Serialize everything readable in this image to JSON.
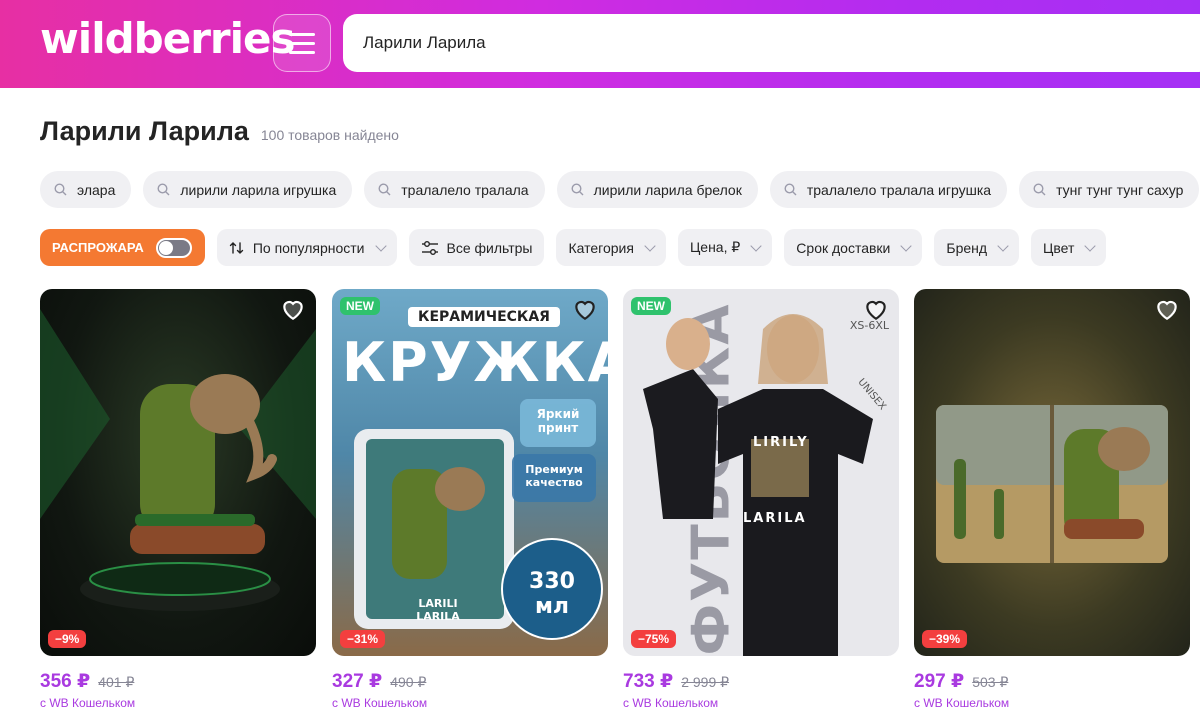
{
  "header": {
    "logo": "wildberries",
    "search_value": "Ларили Ларила"
  },
  "page": {
    "title": "Ларили Ларила",
    "count": "100 товаров найдено"
  },
  "suggestions": [
    "элара",
    "лирили ларила игрушка",
    "тралалело тралала",
    "лирили ларила брелок",
    "тралалело тралала игрушка",
    "тунг тунг тунг сахур"
  ],
  "filters": {
    "sale_label": "РАСПРОЖАРА",
    "sort_label": "По популярности",
    "all_filters": "Все фильтры",
    "category": "Категория",
    "price": "Цена, ₽",
    "delivery": "Срок доставки",
    "brand": "Бренд",
    "color": "Цвет"
  },
  "products": [
    {
      "price": "356 ₽",
      "old_price": "401 ₽",
      "discount": "−9%",
      "wallet": "с WB Кошельком",
      "new": false
    },
    {
      "price": "327 ₽",
      "old_price": "490 ₽",
      "discount": "−31%",
      "wallet": "с WB Кошельком",
      "new": true,
      "img_texts": {
        "t1": "КЕРАМИЧЕСКАЯ",
        "t2": "КРУЖКА",
        "t3": "Яркий принт",
        "t4": "Премиум качество",
        "t5": "330 мл",
        "t6": "LARILI LARILA"
      }
    },
    {
      "price": "733 ₽",
      "old_price": "2 999 ₽",
      "discount": "−75%",
      "wallet": "с WB Кошельком",
      "new": true,
      "img_texts": {
        "t1": "XS-6XL",
        "t2": "ФУТБОЛКА",
        "t3": "LIRILY",
        "t4": "LARILA",
        "t5": "UNISEX"
      }
    },
    {
      "price": "297 ₽",
      "old_price": "503 ₽",
      "discount": "−39%",
      "wallet": "с WB Кошельком",
      "new": false
    }
  ],
  "badges": {
    "new": "NEW"
  },
  "colors": {
    "brand_pink": "#e72fa3",
    "brand_purple": "#a530f5",
    "price": "#a93ae0",
    "sale": "#f47932",
    "discount": "#f33f3f"
  }
}
